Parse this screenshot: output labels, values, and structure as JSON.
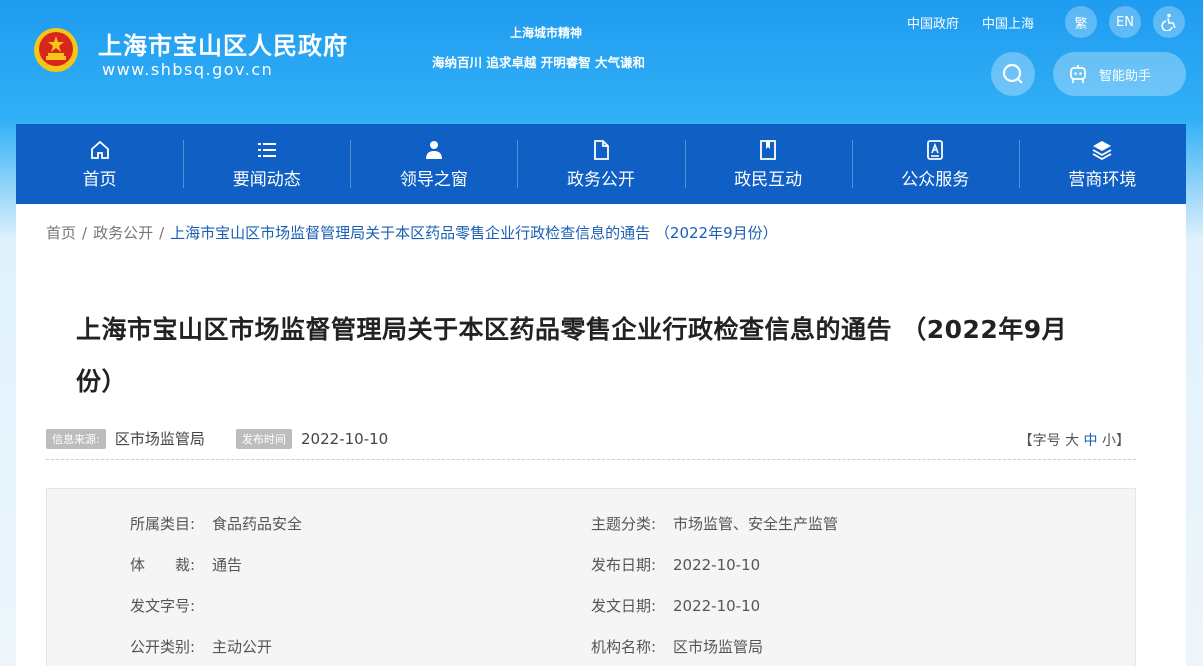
{
  "header": {
    "site_title": "上海市宝山区人民政府",
    "site_url": "www.shbsq.gov.cn",
    "spirit_title": "上海城市精神",
    "spirit_text": "海纳百川 追求卓越 开明睿智 大气谦和",
    "links": [
      "中国政府",
      "中国上海"
    ],
    "traditional_label": "繁",
    "english_label": "EN",
    "accessibility_icon": "wheelchair-icon",
    "search_icon": "search-icon",
    "assistant_label": "智能助手",
    "assistant_icon": "robot-icon"
  },
  "nav": [
    {
      "label": "首页",
      "icon": "home-icon"
    },
    {
      "label": "要闻动态",
      "icon": "list-icon"
    },
    {
      "label": "领导之窗",
      "icon": "person-icon"
    },
    {
      "label": "政务公开",
      "icon": "document-icon"
    },
    {
      "label": "政民互动",
      "icon": "bookmark-icon"
    },
    {
      "label": "公众服务",
      "icon": "service-icon"
    },
    {
      "label": "营商环境",
      "icon": "layers-icon"
    }
  ],
  "breadcrumb": {
    "home": "首页",
    "section": "政务公开",
    "current": "上海市宝山区市场监督管理局关于本区药品零售企业行政检查信息的通告 （2022年9月份）"
  },
  "article": {
    "title_line1": "上海市宝山区市场监督管理局关于本区药品零售企业行政检查信息的通告 （2022年9月",
    "title_line2": "份）",
    "source_tag": "信息来源:",
    "source": "区市场监管局",
    "date_tag": "发布时间",
    "date": "2022-10-10",
    "fontsize_prefix": "【字号",
    "fontsize_large": "大",
    "fontsize_medium": "中",
    "fontsize_small": "小",
    "fontsize_suffix": "】"
  },
  "info": {
    "category_label": "所属类目:",
    "category": "食品药品安全",
    "topic_label": "主题分类:",
    "topic": "市场监管、安全生产监管",
    "genre_label": "体　　裁:",
    "genre": "通告",
    "pub_date_label": "发布日期:",
    "pub_date": "2022-10-10",
    "doc_no_label": "发文字号:",
    "doc_no": "",
    "doc_date_label": "发文日期:",
    "doc_date": "2022-10-10",
    "open_type_label": "公开类别:",
    "open_type": "主动公开",
    "org_label": "机构名称:",
    "org": "区市场监管局"
  },
  "colors": {
    "nav_bg": "#0f5fc4",
    "accent": "#1a5fb4",
    "emblem_red": "#d9261c",
    "emblem_gold": "#f5c518"
  }
}
